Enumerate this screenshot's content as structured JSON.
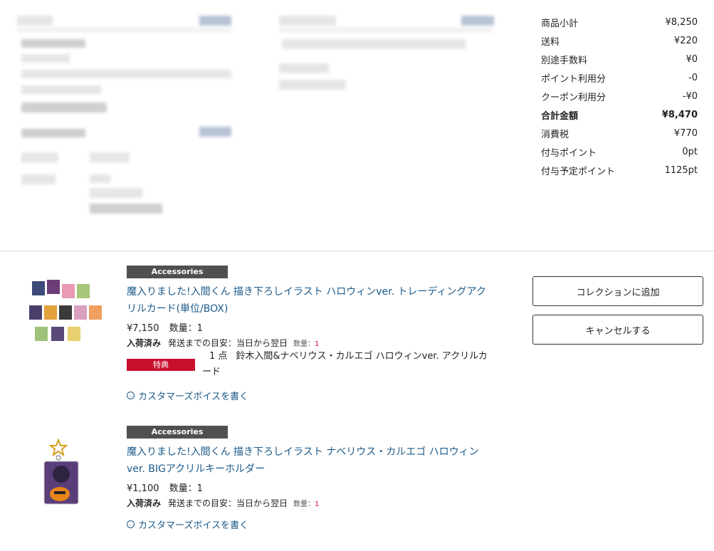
{
  "summary": [
    {
      "label": "商品小計",
      "value": "¥8,250"
    },
    {
      "label": "送料",
      "value": "¥220"
    },
    {
      "label": "別途手数料",
      "value": "¥0"
    },
    {
      "label": "ポイント利用分",
      "value": "-0"
    },
    {
      "label": "クーポン利用分",
      "value": "-¥0"
    },
    {
      "label": "合計金額",
      "value": "¥8,470",
      "bold": true
    },
    {
      "label": "消費税",
      "value": "¥770"
    },
    {
      "label": "付与ポイント",
      "value": "0pt"
    },
    {
      "label": "付与予定ポイント",
      "value": "1125pt"
    }
  ],
  "items": [
    {
      "category": "Accessories",
      "title": "魔入りました!入間くん 描き下ろしイラスト ハロウィンver. トレーディングアクリルカード(単位/BOX)",
      "price": "¥7,150",
      "quantity": "数量：1",
      "stock": "入荷済み",
      "shipping": "発送までの目安：当日から翌日",
      "qty_label": "数量：",
      "qty_value": "1",
      "bonus_label": "特典",
      "bonus_count": "1 点",
      "bonus_text": "鈴木入間&ナベリウス・カルエゴ ハロウィンver. アクリルカード",
      "voice_link": "カスタマーズボイスを書く"
    },
    {
      "category": "Accessories",
      "title": "魔入りました!入間くん 描き下ろしイラスト ナベリウス・カルエゴ ハロウィンver. BIGアクリルキーホルダー",
      "price": "¥1,100",
      "quantity": "数量：1",
      "stock": "入荷済み",
      "shipping": "発送までの目安：当日から翌日",
      "qty_label": "数量：",
      "qty_value": "1",
      "voice_link": "カスタマーズボイスを書く"
    }
  ],
  "actions": {
    "add_collection": "コレクションに追加",
    "cancel": "キャンセルする"
  },
  "colors": {
    "link": "#1a5a8a",
    "accent_red": "#c8102e",
    "badge_gray": "#505050"
  }
}
